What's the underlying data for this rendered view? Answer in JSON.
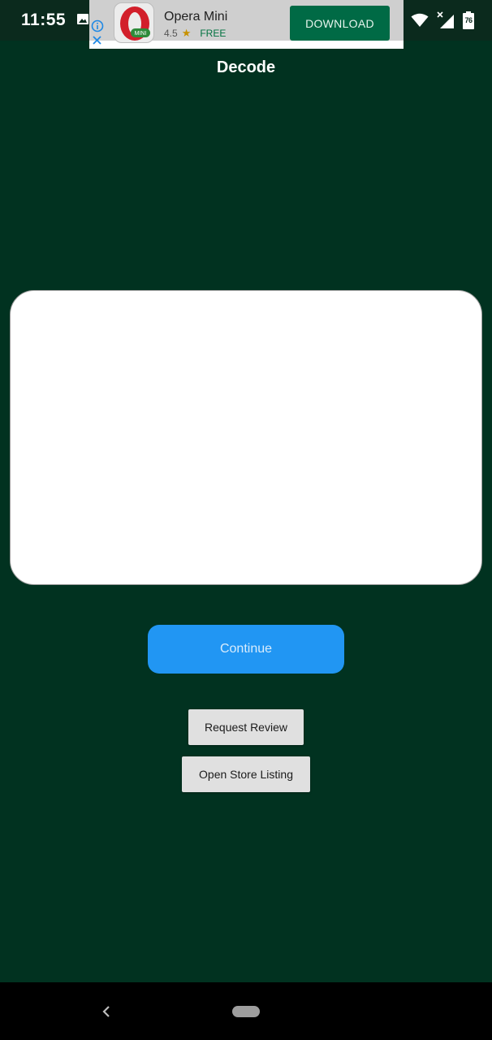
{
  "status_bar": {
    "time": "11:55",
    "battery": "76",
    "icons": [
      "image-icon",
      "alarm-icon",
      "wifi-icon",
      "signal-icon",
      "battery-icon"
    ]
  },
  "ad": {
    "app_name": "Opera Mini",
    "rating": "4.5",
    "price": "FREE",
    "cta": "DOWNLOAD",
    "app_icon_badge": "MINI",
    "icons": [
      "info-icon",
      "close-icon",
      "star-icon"
    ]
  },
  "header": {
    "title": "Decode"
  },
  "main": {
    "input_value": "",
    "continue_label": "Continue",
    "request_review_label": "Request Review",
    "open_store_label": "Open Store Listing"
  },
  "nav_bar": {
    "icons": [
      "back-icon",
      "home-pill-icon"
    ]
  },
  "colors": {
    "background": "#013220",
    "primary_button": "#2196f3",
    "secondary_button": "#e0e0e0",
    "ad_cta": "#006a45"
  }
}
